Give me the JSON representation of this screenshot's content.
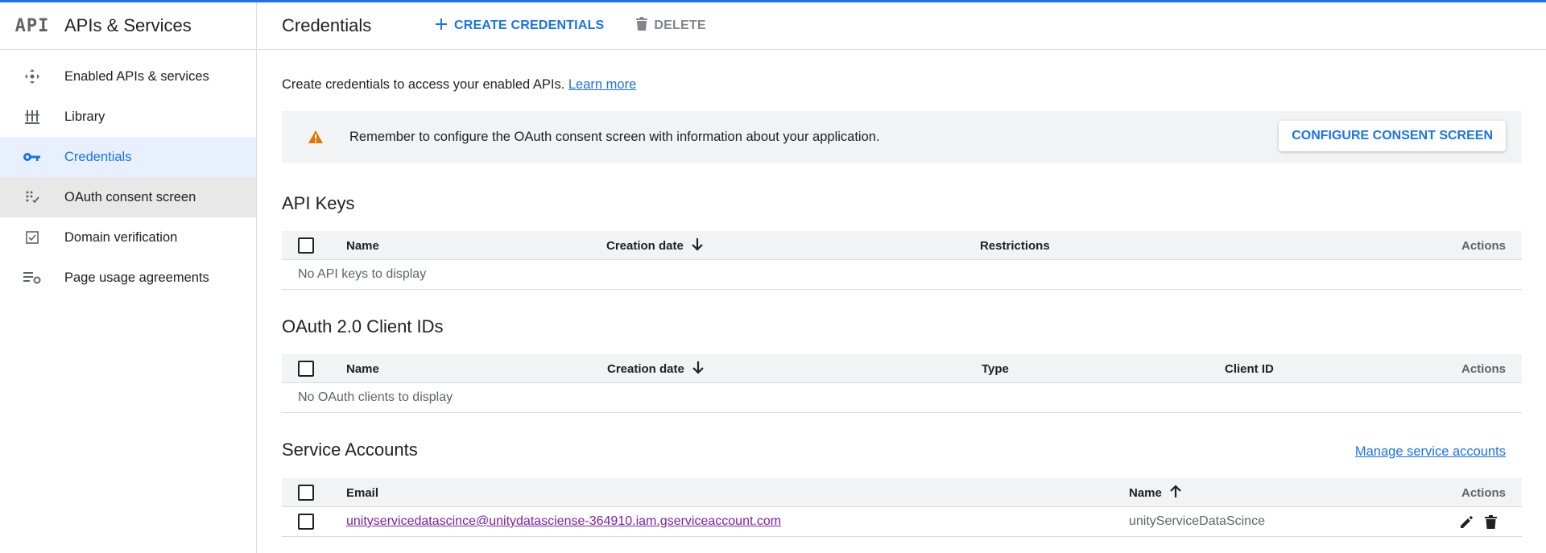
{
  "app": {
    "logo_text": "API",
    "title": "APIs & Services"
  },
  "sidebar": {
    "items": [
      {
        "label": "Enabled APIs & services",
        "icon": "diamond-arrows-icon"
      },
      {
        "label": "Library",
        "icon": "library-icon"
      },
      {
        "label": "Credentials",
        "icon": "key-icon",
        "active": true
      },
      {
        "label": "OAuth consent screen",
        "icon": "consent-icon"
      },
      {
        "label": "Domain verification",
        "icon": "checkbox-icon"
      },
      {
        "label": "Page usage agreements",
        "icon": "settings-list-icon"
      }
    ]
  },
  "header": {
    "title": "Credentials",
    "create_label": "CREATE CREDENTIALS",
    "delete_label": "DELETE"
  },
  "intro": {
    "text": "Create credentials to access your enabled APIs.",
    "link": "Learn more"
  },
  "banner": {
    "text": "Remember to configure the OAuth consent screen with information about your application.",
    "button": "CONFIGURE CONSENT SCREEN"
  },
  "api_keys": {
    "title": "API Keys",
    "columns": {
      "name": "Name",
      "creation_date": "Creation date",
      "restrictions": "Restrictions",
      "actions": "Actions"
    },
    "empty": "No API keys to display"
  },
  "oauth": {
    "title": "OAuth 2.0 Client IDs",
    "columns": {
      "name": "Name",
      "creation_date": "Creation date",
      "type": "Type",
      "client_id": "Client ID",
      "actions": "Actions"
    },
    "empty": "No OAuth clients to display"
  },
  "service_accounts": {
    "title": "Service Accounts",
    "manage_link": "Manage service accounts",
    "columns": {
      "email": "Email",
      "name": "Name",
      "actions": "Actions"
    },
    "rows": [
      {
        "email": "unityservicedatascince@unitydatasciense-364910.iam.gserviceaccount.com",
        "name": "unityServiceDataScince"
      }
    ]
  },
  "colors": {
    "accent": "#1a73e8",
    "warning": "#e37400",
    "visited_link": "#7b1fa2"
  }
}
